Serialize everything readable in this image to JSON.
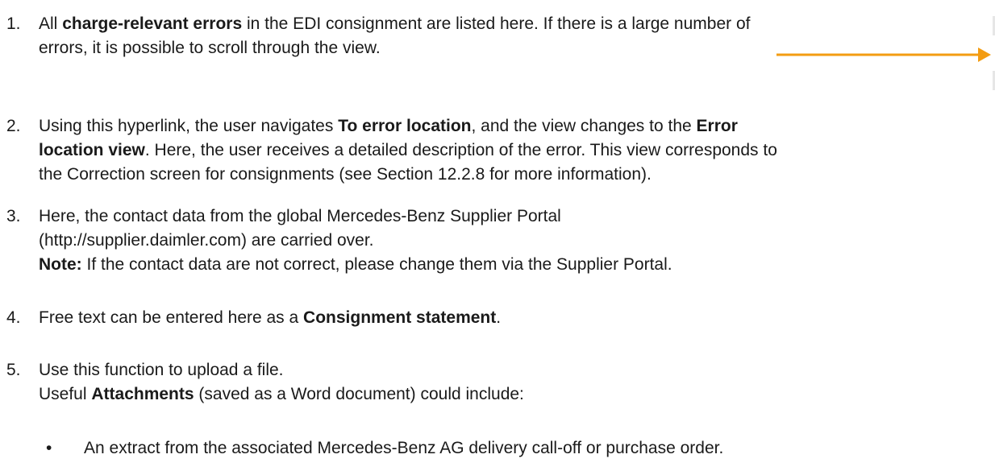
{
  "items": [
    {
      "number": "1.",
      "lines": [
        {
          "pre": "All ",
          "bold": "charge-relevant errors",
          "post": " in the EDI consignment are listed here. If there is a large number of"
        },
        {
          "text": "errors, it is possible to scroll through the view."
        }
      ]
    },
    {
      "number": "2.",
      "lines": [
        {
          "pre": "Using this hyperlink, the user navigates ",
          "bold": "To error location",
          "mid": ", and the view changes to the ",
          "bold2": "Error"
        },
        {
          "bold": "location view",
          "post": ". Here, the user receives a detailed description of the error. This view corresponds to"
        },
        {
          "text": "the Correction screen for consignments (see Section 12.2.8 for more information)."
        }
      ]
    },
    {
      "number": "3.",
      "lines": [
        {
          "text": "Here, the contact data from the global Mercedes-Benz Supplier Portal"
        },
        {
          "text": "(http://supplier.daimler.com) are carried over."
        },
        {
          "bold": "Note:",
          "post": " If the contact data are not correct, please change them via the Supplier Portal."
        }
      ]
    },
    {
      "number": "4.",
      "lines": [
        {
          "pre": "Free text can be entered here as a ",
          "bold": "Consignment statement",
          "post": "."
        }
      ]
    },
    {
      "number": "5.",
      "lines": [
        {
          "text": "Use this function to upload a file."
        },
        {
          "pre": "Useful ",
          "bold": "Attachments",
          "post": " (saved as a Word document) could include:"
        }
      ]
    }
  ],
  "bullets": [
    {
      "symbol": "•",
      "text": "An extract from the associated Mercedes-Benz AG delivery call-off or purchase order."
    }
  ],
  "colors": {
    "arrow": "#f39c12",
    "text": "#1a1a1a"
  }
}
